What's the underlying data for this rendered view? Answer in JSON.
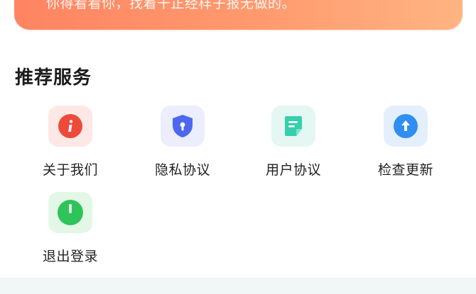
{
  "banner": {
    "text": "你得看看你，找着干正经样子报无做的。"
  },
  "section": {
    "title": "推荐服务"
  },
  "services": [
    {
      "label": "关于我们",
      "icon": "info-icon",
      "tile_color": "#fde8e6",
      "icon_color": "#ee4a3a"
    },
    {
      "label": "隐私协议",
      "icon": "shield-lock-icon",
      "tile_color": "#eceefe",
      "icon_color": "#4d68ee"
    },
    {
      "label": "用户协议",
      "icon": "document-icon",
      "tile_color": "#e4f7f3",
      "icon_color": "#37cfae"
    },
    {
      "label": "检查更新",
      "icon": "arrow-up-icon",
      "tile_color": "#e4effd",
      "icon_color": "#2f8ef0"
    },
    {
      "label": "退出登录",
      "icon": "power-icon",
      "tile_color": "#e3f7e7",
      "icon_color": "#2ec45a"
    }
  ]
}
